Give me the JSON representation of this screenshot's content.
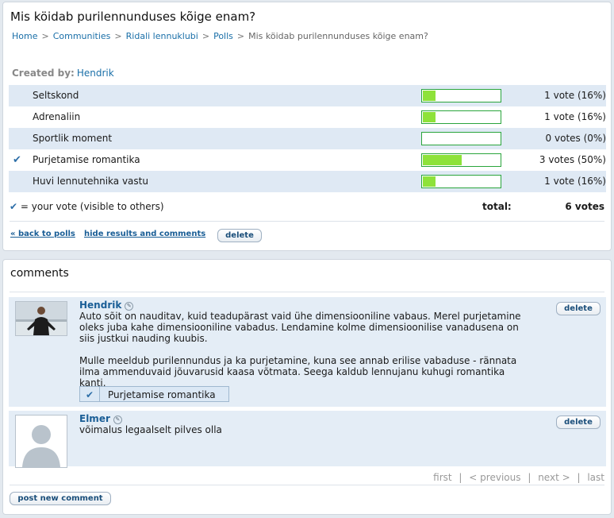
{
  "poll": {
    "title": "Mis köidab purilennunduses kõige enam?",
    "breadcrumb": [
      "Home",
      "Communities",
      "Ridali lennuklubi",
      "Polls",
      "Mis köidab purilennunduses kõige enam?"
    ],
    "breadcrumb_sep": ">",
    "created_by_label": "Created by:",
    "created_by": "Hendrik",
    "options": [
      {
        "label": "Seltskond",
        "votes_text": "1 vote (16%)",
        "percent": 16,
        "voted": false
      },
      {
        "label": "Adrenaliin",
        "votes_text": "1 vote (16%)",
        "percent": 16,
        "voted": false
      },
      {
        "label": "Sportlik moment",
        "votes_text": "0 votes (0%)",
        "percent": 0,
        "voted": false
      },
      {
        "label": "Purjetamise romantika",
        "votes_text": "3 votes (50%)",
        "percent": 50,
        "voted": true
      },
      {
        "label": "Huvi lennutehnika vastu",
        "votes_text": "1 vote (16%)",
        "percent": 16,
        "voted": false
      }
    ],
    "legend": "= your vote (visible to others)",
    "total_label": "total:",
    "total_value": "6 votes",
    "back_link": "« back to polls",
    "hide_link": "hide results and comments",
    "delete_label": "delete"
  },
  "comments": {
    "title": "comments",
    "items": [
      {
        "author": "Hendrik",
        "paragraphs": [
          "Auto sõit on nauditav, kuid teadupärast vaid ühe dimensiooniline vabaus. Merel purjetamine oleks juba kahe dimensiooniline vabadus. Lendamine kolme dimensioonilise vanadusena on siis justkui nauding kuubis.",
          "Mulle meeldub purilennundus ja ka purjetamine, kuna see annab erilise vabaduse - rännata ilma ammenduvaid jõuvarusid kaasa võtmata. Seega kaldub lennujanu kuhugi romantika kanti."
        ],
        "vote": "Purjetamise romantika",
        "delete_label": "delete"
      },
      {
        "author": "Elmer",
        "paragraphs": [
          "võimalus legaalselt pilves olla"
        ],
        "delete_label": "delete"
      }
    ],
    "pager": {
      "first": "first",
      "previous": "< previous",
      "next": "next >",
      "last": "last",
      "sep": "|"
    },
    "post_button": "post new comment"
  },
  "colors": {
    "link": "#1a6fa8",
    "bar_fill": "#8ee23a",
    "bar_border": "#2aa53c",
    "row_shade": "#dfe9f4"
  }
}
